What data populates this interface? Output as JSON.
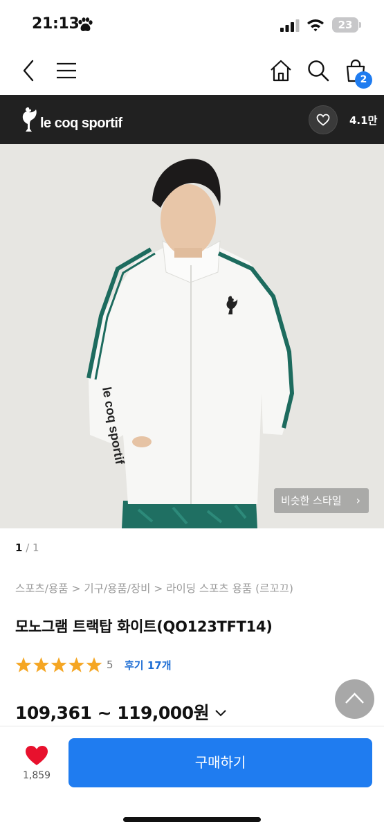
{
  "status_bar": {
    "time": "21:13",
    "battery": "23"
  },
  "header": {
    "cart_count": "2"
  },
  "brand": {
    "name": "le coq sportif",
    "likes": "4.1만"
  },
  "image": {
    "similar_style_label": "비슷한 스타일",
    "page_current": "1",
    "page_total": "/ 1"
  },
  "product": {
    "breadcrumb": "스포츠/용품 > 기구/용품/장비 > 라이딩 스포츠 용품 (르꼬끄)",
    "title": "모노그램 트랙탑 화이트(QO123TFT14)",
    "rating": "5",
    "rating_fraction": 1.0,
    "review_link": "후기 17개",
    "price_range": "109,361 ~ 119,000원"
  },
  "bottom": {
    "wish_count": "1,859",
    "buy_label": "구매하기"
  },
  "colors": {
    "accent": "#1f7cf0",
    "star": "#f5a623",
    "heart": "#e8112d",
    "brand_bar": "#212121"
  }
}
